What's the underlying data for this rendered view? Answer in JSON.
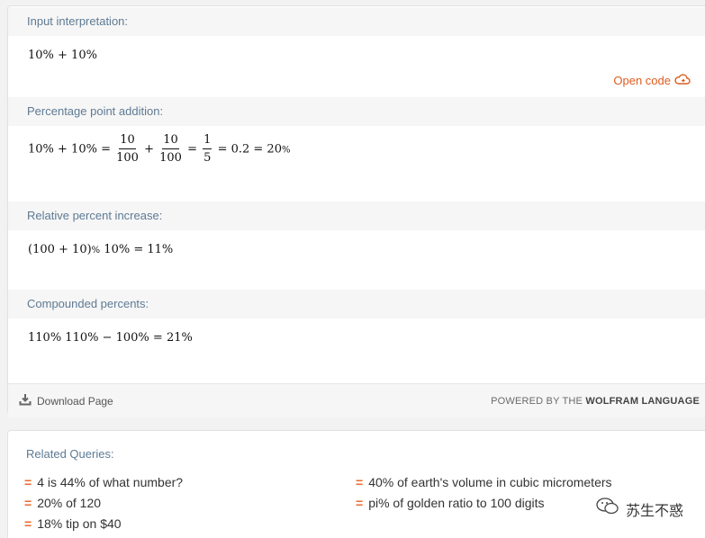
{
  "pods": [
    {
      "title": "Input interpretation:",
      "expr": "10% + 10%"
    },
    {
      "title": "Percentage point addition:",
      "lhs": "10% + 10% =",
      "f1_num": "10",
      "f1_den": "100",
      "plus": "+",
      "f2_num": "10",
      "f2_den": "100",
      "eq1": "=",
      "f3_num": "1",
      "f3_den": "5",
      "tail": "= 0.2 = 20",
      "tail_small": "%"
    },
    {
      "title": "Relative percent increase:",
      "pre": "(100 + 10)",
      "small": "%",
      "post": " 10% = 11%"
    },
    {
      "title": "Compounded percents:",
      "expr": "110% 110% − 100% = 21%"
    }
  ],
  "open_code": "Open code",
  "footer": {
    "download": "Download Page",
    "powered_prefix": "POWERED BY THE ",
    "powered_brand": "WOLFRAM LANGUAGE"
  },
  "related": {
    "title": "Related Queries:",
    "marker": "=",
    "left": [
      "4 is 44% of what number?",
      "20% of 120",
      "18% tip on $40"
    ],
    "right": [
      "40% of earth's volume in cubic micrometers",
      "pi% of golden ratio to 100 digits"
    ]
  },
  "watermark": "苏生不惑",
  "colors": {
    "accent": "#dd5c1f",
    "header_text": "#5e7a94",
    "marker": "#ee6a2a"
  }
}
